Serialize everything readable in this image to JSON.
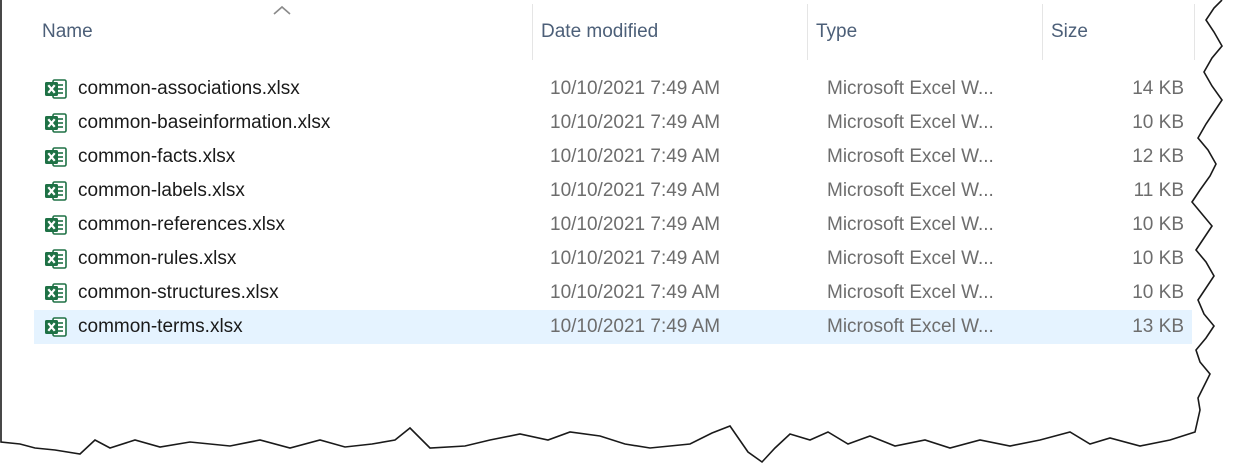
{
  "columns": {
    "name": "Name",
    "date_modified": "Date modified",
    "type": "Type",
    "size": "Size"
  },
  "sort": {
    "column": "name",
    "direction": "ascending"
  },
  "icon": "excel-file-icon",
  "colors": {
    "excel_green": "#1e7145",
    "selected_row": "#e5f3ff",
    "header_text": "#4c5f78"
  },
  "files": [
    {
      "name": "common-associations.xlsx",
      "date": "10/10/2021 7:49 AM",
      "type": "Microsoft Excel W...",
      "size": "14 KB"
    },
    {
      "name": "common-baseinformation.xlsx",
      "date": "10/10/2021 7:49 AM",
      "type": "Microsoft Excel W...",
      "size": "10 KB"
    },
    {
      "name": "common-facts.xlsx",
      "date": "10/10/2021 7:49 AM",
      "type": "Microsoft Excel W...",
      "size": "12 KB"
    },
    {
      "name": "common-labels.xlsx",
      "date": "10/10/2021 7:49 AM",
      "type": "Microsoft Excel W...",
      "size": "11 KB"
    },
    {
      "name": "common-references.xlsx",
      "date": "10/10/2021 7:49 AM",
      "type": "Microsoft Excel W...",
      "size": "10 KB"
    },
    {
      "name": "common-rules.xlsx",
      "date": "10/10/2021 7:49 AM",
      "type": "Microsoft Excel W...",
      "size": "10 KB"
    },
    {
      "name": "common-structures.xlsx",
      "date": "10/10/2021 7:49 AM",
      "type": "Microsoft Excel W...",
      "size": "10 KB"
    },
    {
      "name": "common-terms.xlsx",
      "date": "10/10/2021 7:49 AM",
      "type": "Microsoft Excel W...",
      "size": "13 KB"
    }
  ],
  "selected_index": 7
}
